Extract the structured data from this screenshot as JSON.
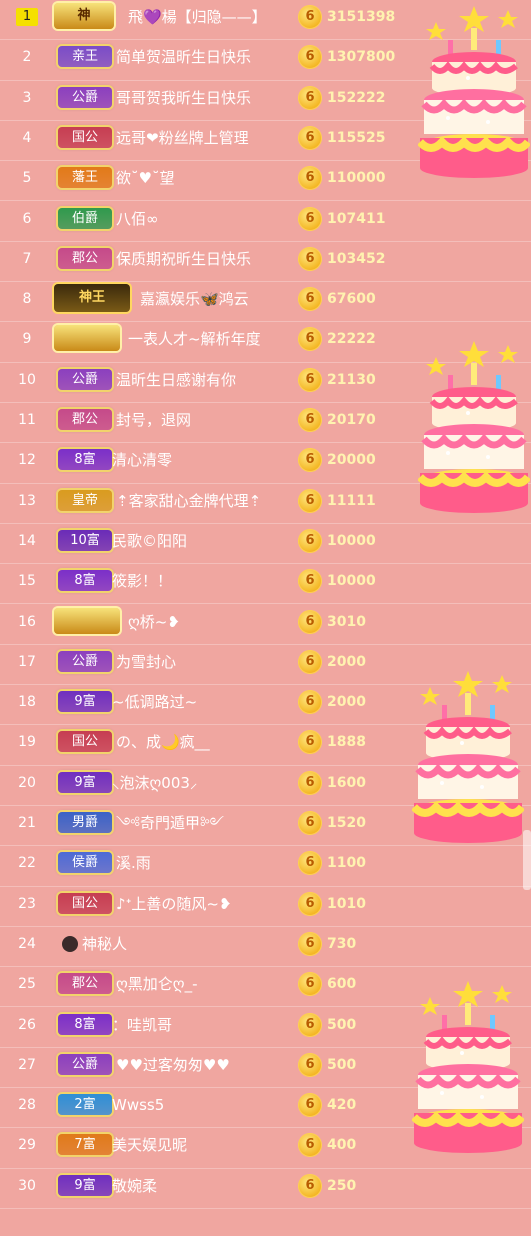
{
  "rows": [
    {
      "rank": "1",
      "badge": "神",
      "badge_style": "crown",
      "name": "飛💜楊【归隐——】",
      "score": "3151398"
    },
    {
      "rank": "2",
      "badge": "亲王",
      "color": "#7a4cc8",
      "name": "简单贺温昕生日快乐",
      "score": "1307800"
    },
    {
      "rank": "3",
      "badge": "公爵",
      "color": "#8b3fbf",
      "name": "哥哥贺我昕生日快乐",
      "score": "152222"
    },
    {
      "rank": "4",
      "badge": "国公",
      "color": "#c63d52",
      "name": "远哥❤粉丝牌上管理",
      "score": "115525"
    },
    {
      "rank": "5",
      "badge": "藩王",
      "color": "#e27a18",
      "name": "欲˘♥˘望",
      "score": "110000"
    },
    {
      "rank": "6",
      "badge": "伯爵",
      "color": "#2f9a4d",
      "name": "八佰∞",
      "score": "107411"
    },
    {
      "rank": "7",
      "badge": "郡公",
      "color": "#c54a8a",
      "name": "保质期祝昕生日快乐",
      "score": "103452"
    },
    {
      "rank": "8",
      "badge": "神王",
      "badge_style": "crown2",
      "name": "嘉瀛娱乐🦋鸿云",
      "score": "67600"
    },
    {
      "rank": "9",
      "badge": "",
      "badge_style": "crown-empty",
      "name": "一表人才~解析年度",
      "score": "22222"
    },
    {
      "rank": "10",
      "badge": "公爵",
      "color": "#8b3fbf",
      "name": "温昕生日感谢有你",
      "score": "21130"
    },
    {
      "rank": "11",
      "badge": "郡公",
      "color": "#c54a8a",
      "name": "封号，退网",
      "score": "20170"
    },
    {
      "rank": "12",
      "badge": "8富",
      "color": "#7b2fc9",
      "name": "清心清零",
      "score": "20000"
    },
    {
      "rank": "13",
      "badge": "皇帝",
      "color": "#d99c1f",
      "name": "⇡客家甜心金牌代理⇡",
      "score": "11111"
    },
    {
      "rank": "14",
      "badge": "10富",
      "color": "#6a2bb8",
      "name": "民歌©阳阳",
      "score": "10000"
    },
    {
      "rank": "15",
      "badge": "8富",
      "color": "#7b2fc9",
      "name": "筱影！！",
      "score": "10000"
    },
    {
      "rank": "16",
      "badge": "",
      "badge_style": "crown-empty",
      "name": "ღ桥~❥",
      "score": "3010"
    },
    {
      "rank": "17",
      "badge": "公爵",
      "color": "#8b3fbf",
      "name": "为雪封心",
      "score": "2000"
    },
    {
      "rank": "18",
      "badge": "9富",
      "color": "#6f2fc0",
      "name": "~低调路过~",
      "score": "2000"
    },
    {
      "rank": "19",
      "badge": "国公",
      "color": "#c63d52",
      "name": "の、成🌙疯__",
      "score": "1888"
    },
    {
      "rank": "20",
      "badge": "9富",
      "color": "#6f2fc0",
      "name": "⸜泡沫ღ003⸝",
      "score": "1600"
    },
    {
      "rank": "21",
      "badge": "男爵",
      "color": "#3a62c8",
      "name": "༺奇門遁甲༻",
      "score": "1520"
    },
    {
      "rank": "22",
      "badge": "侯爵",
      "color": "#4d6ad6",
      "name": "溪.雨",
      "score": "1100"
    },
    {
      "rank": "23",
      "badge": "国公",
      "color": "#c63d52",
      "name": "♪ᐩ上善の随风~❥",
      "score": "1010"
    },
    {
      "rank": "24",
      "badge": "",
      "badge_style": "mystery",
      "name": "神秘人",
      "score": "730"
    },
    {
      "rank": "25",
      "badge": "郡公",
      "color": "#c54a8a",
      "name": "ღ黑加仑ღ_-",
      "score": "600"
    },
    {
      "rank": "26",
      "badge": "8富",
      "color": "#7b2fc9",
      "name": "：哇凯哥",
      "score": "500"
    },
    {
      "rank": "27",
      "badge": "公爵",
      "color": "#8b3fbf",
      "name": "♥♥过客匆匆♥♥",
      "score": "500"
    },
    {
      "rank": "28",
      "badge": "2富",
      "color": "#2f8fd6",
      "name": "Wwss5",
      "score": "420"
    },
    {
      "rank": "29",
      "badge": "7富",
      "color": "#e07a1a",
      "name": "美天娱见昵",
      "score": "400"
    },
    {
      "rank": "30",
      "badge": "9富",
      "color": "#6f2fc0",
      "name": "敬婉柔",
      "score": "250"
    }
  ],
  "coin_glyph": "6",
  "icons": {
    "coin": "coin-icon",
    "cake": "birthday-cake-icon",
    "mystery": "mystery-person-icon"
  }
}
